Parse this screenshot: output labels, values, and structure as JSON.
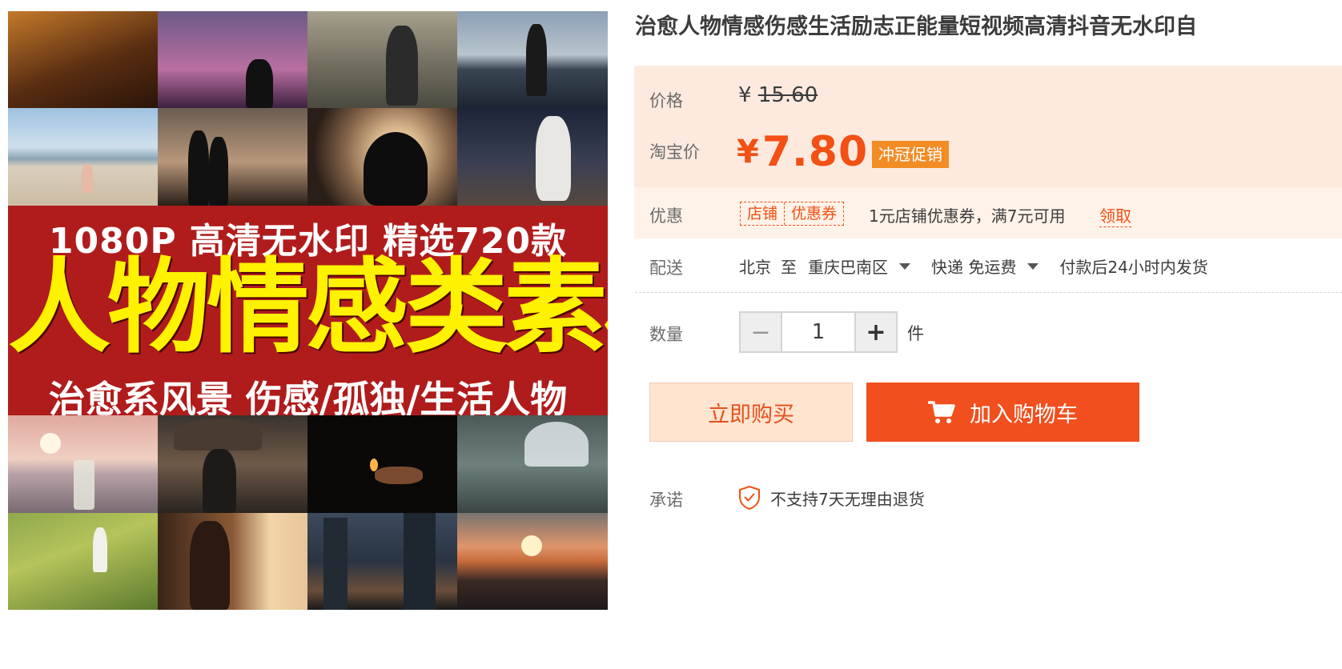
{
  "product": {
    "title": "治愈人物情感伤感生活励志正能量短视频高清抖音无水印自",
    "image": {
      "banner_line1": "1080P 高清无水印 精选720款",
      "banner_line2": "人物情感类素材",
      "banner_line3": "治愈系风景 伤感/孤独/生活人物"
    }
  },
  "price": {
    "label": "价格",
    "currency": "¥",
    "original": "15.60"
  },
  "promo": {
    "label": "淘宝价",
    "currency": "¥",
    "price": "7.80",
    "tag": "冲冠促销"
  },
  "coupon": {
    "label": "优惠",
    "badge_left": "店铺",
    "badge_right": "优惠券",
    "text": "1元店铺优惠券，满7元可用",
    "link": "领取"
  },
  "delivery": {
    "label": "配送",
    "from": "北京",
    "to_word": "至",
    "destination": "重庆巴南区",
    "shipping": "快递 免运费",
    "dispatch": "付款后24小时内发货"
  },
  "quantity": {
    "label": "数量",
    "minus": "−",
    "plus": "+",
    "value": "1",
    "unit": "件"
  },
  "buttons": {
    "buy_now": "立即购买",
    "add_to_cart": "加入购物车"
  },
  "promise": {
    "label": "承诺",
    "text": "不支持7天无理由退货"
  },
  "colors": {
    "accent": "#f24f1e",
    "price": "#f25014",
    "promo_tag": "#f28c25",
    "panel_bg": "#fde9de"
  },
  "icons": {
    "cart": "shopping-cart-icon",
    "shield": "shield-check-icon",
    "caret": "chevron-down-icon"
  }
}
